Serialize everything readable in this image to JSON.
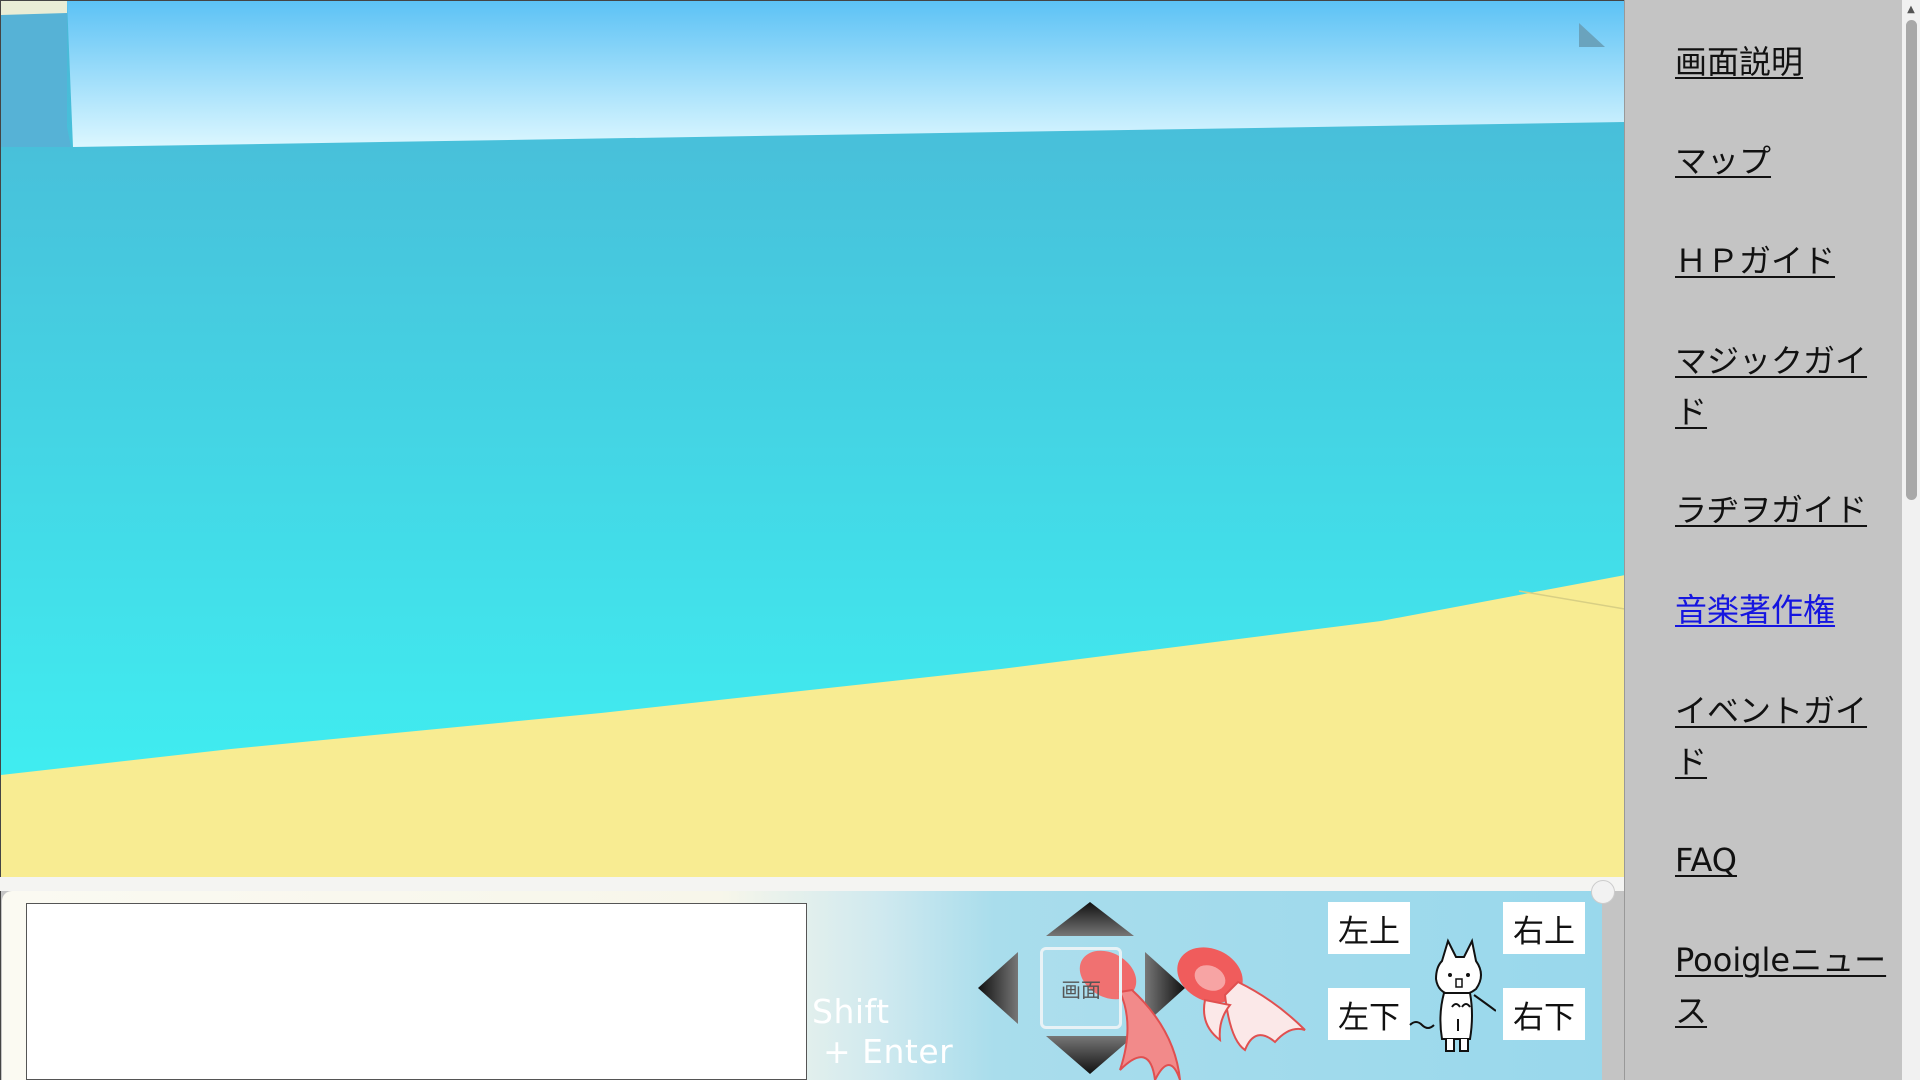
{
  "controls": {
    "chat_placeholder": "",
    "send_hint": "Shift\n + Enter",
    "screen_button": "画面",
    "up_left": "左上",
    "up_right": "右上",
    "down_left": "左下",
    "down_right": "右下"
  },
  "icons": {
    "corner_marker": "triangle-icon",
    "arrows": [
      "arrow-up-icon",
      "arrow-down-icon",
      "arrow-left-icon",
      "arrow-right-icon"
    ],
    "mascot": "cat-icon",
    "decoration": "goldfish-icon"
  },
  "sidebar": {
    "items": [
      {
        "label": "画面説明"
      },
      {
        "label": "マップ"
      },
      {
        "label": "ＨＰガイド"
      },
      {
        "label": "マジックガイド"
      },
      {
        "label": "ラヂヲガイド"
      },
      {
        "label": "音楽著作権"
      },
      {
        "label": "イベントガイド"
      },
      {
        "label": "FAQ"
      },
      {
        "label": "Pooigleニュース"
      }
    ],
    "visited_index": 5
  },
  "colors": {
    "sky_top": "#5fc3f5",
    "sky_bottom": "#d8f6ff",
    "sea_far": "#4ab8d6",
    "sea_near": "#3ff0f2",
    "sand": "#f8ec92",
    "sidebar_bg": "#c4c4c4",
    "visited_link": "#1515e0"
  }
}
